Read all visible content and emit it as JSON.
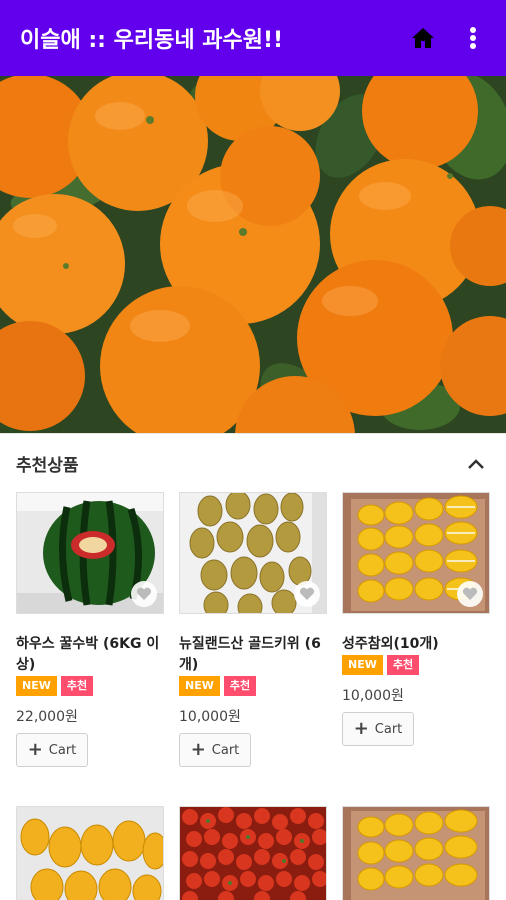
{
  "appbar": {
    "title": "이슬애 :: 우리동네 과수원!!",
    "home_icon": "home-icon",
    "menu_icon": "more-vert-icon",
    "background": "#6200ee"
  },
  "section": {
    "title": "추천상품",
    "toggle_icon": "chevron-up-icon"
  },
  "products": [
    {
      "name": "하우스 꿀수박 (6KG 이상)",
      "badges": [
        "NEW",
        "추천"
      ],
      "price": "22,000원",
      "cart_label": "Cart"
    },
    {
      "name": "뉴질랜드산 골드키위 (6개)",
      "badges": [
        "NEW",
        "추천"
      ],
      "price": "10,000원",
      "cart_label": "Cart"
    },
    {
      "name": "성주참외(10개)",
      "badges": [
        "NEW",
        "추천"
      ],
      "price": "10,000원",
      "cart_label": "Cart"
    }
  ],
  "colors": {
    "badge_new": "#ffa200",
    "badge_recommend": "#ff4d6d"
  }
}
